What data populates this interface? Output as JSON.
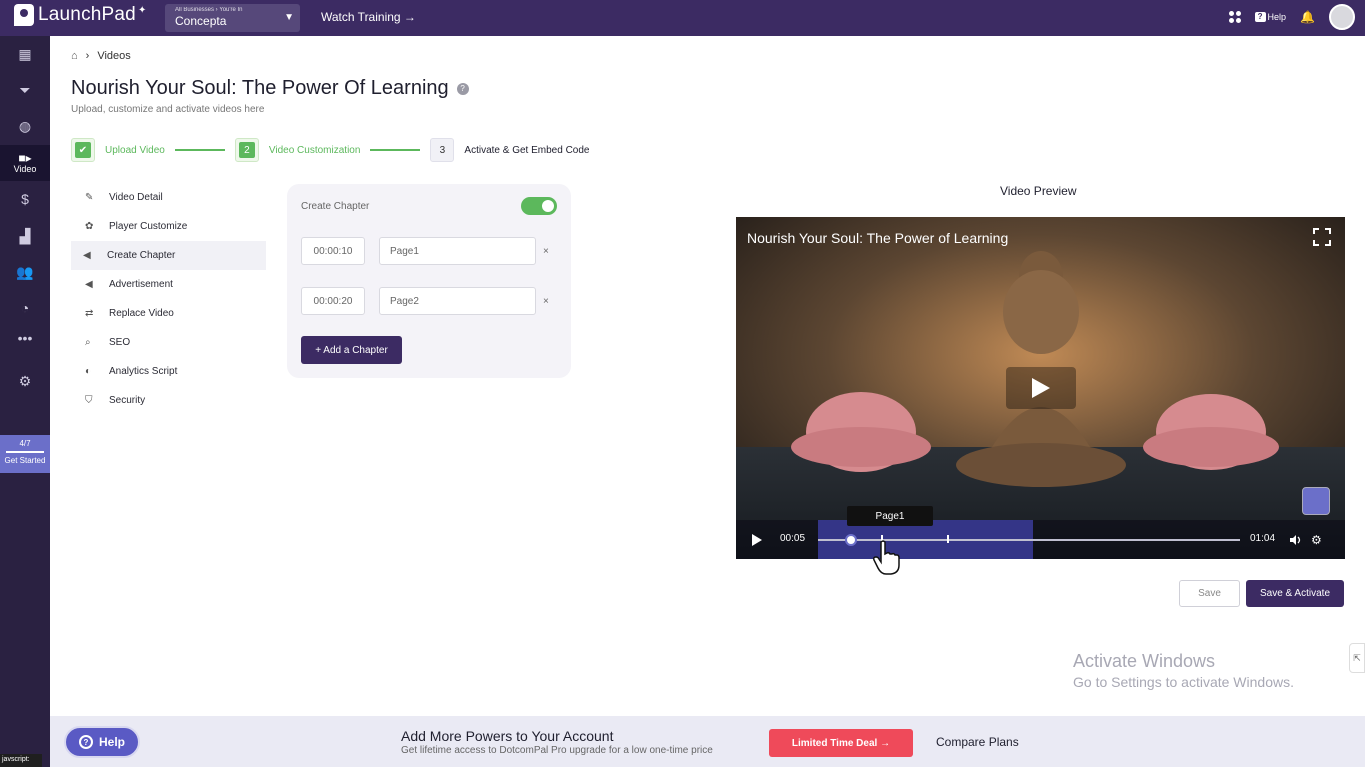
{
  "topbar": {
    "logo": "LaunchPad",
    "business_sub": "All Businesses › You're In",
    "business_name": "Concepta",
    "watch_training": "Watch Training →",
    "help": "Help"
  },
  "sidenav": {
    "video_label": "Video",
    "progress": "4/7",
    "get_started": "Get Started",
    "status_bar": "javscript:"
  },
  "breadcrumb": {
    "current": "Videos"
  },
  "page": {
    "title": "Nourish Your Soul: The Power Of Learning",
    "subtitle": "Upload, customize and activate videos here"
  },
  "steps": [
    {
      "number": "",
      "label": "Upload Video",
      "state": "done"
    },
    {
      "number": "2",
      "label": "Video Customization",
      "state": "current"
    },
    {
      "number": "3",
      "label": "Activate & Get Embed Code",
      "state": "pending"
    }
  ],
  "submenu": [
    {
      "label": "Video Detail",
      "icon": "edit-icon"
    },
    {
      "label": "Player Customize",
      "icon": "palette-icon"
    },
    {
      "label": "Create Chapter",
      "icon": "megaphone-icon"
    },
    {
      "label": "Advertisement",
      "icon": "megaphone-icon"
    },
    {
      "label": "Replace Video",
      "icon": "swap-icon"
    },
    {
      "label": "SEO",
      "icon": "search-icon"
    },
    {
      "label": "Analytics Script",
      "icon": "analytics-icon"
    },
    {
      "label": "Security",
      "icon": "shield-icon"
    }
  ],
  "chapters": {
    "title": "Create Chapter",
    "enabled": true,
    "rows": [
      {
        "time": "00:00:10",
        "name": "Page1"
      },
      {
        "time": "00:00:20",
        "name": "Page2"
      }
    ],
    "add_label": "+ Add a Chapter",
    "remove_glyph": "×"
  },
  "preview": {
    "heading": "Video Preview",
    "video_title": "Nourish Your Soul: The Power of Learning",
    "current_time": "00:05",
    "duration": "01:04",
    "tooltip": "Page1",
    "progress_fraction": 0.078
  },
  "actions": {
    "save": "Save",
    "save_activate": "Save & Activate"
  },
  "watermark": {
    "line1": "Activate Windows",
    "line2": "Go to Settings to activate Windows."
  },
  "footer": {
    "help": "Help",
    "title": "Add More Powers to Your Account",
    "subtitle": "Get lifetime access to DotcomPal Pro upgrade for a low one-time price",
    "deal": "Limited Time Deal →",
    "compare": "Compare Plans"
  },
  "colors": {
    "brand": "#3c2b63",
    "accent_green": "#5cb85c",
    "deal_red": "#ef4a5a"
  }
}
